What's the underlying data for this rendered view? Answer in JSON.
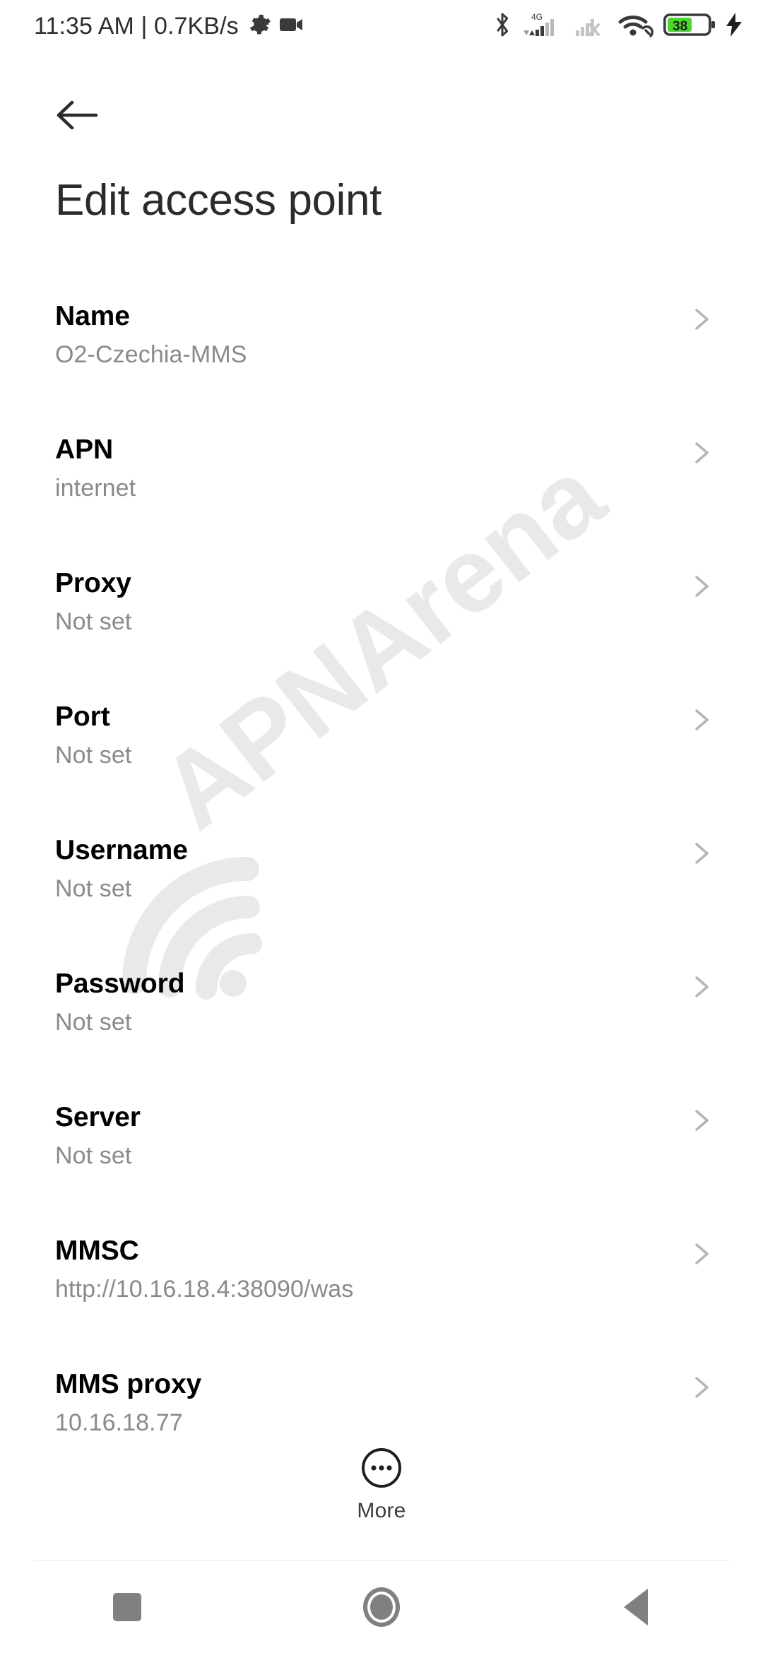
{
  "status_bar": {
    "time": "11:35 AM",
    "separator": "|",
    "data_speed": "0.7KB/s",
    "left_icons": [
      "gear-icon",
      "camcorder-icon"
    ],
    "network_label": "4G",
    "battery_percent": "38",
    "battery_color": "#4ad62f",
    "right_icons": [
      "bluetooth-icon",
      "signal-4g-icon",
      "signal-sim2-off-icon",
      "wifi-icon",
      "battery-icon",
      "charging-bolt-icon"
    ]
  },
  "app_bar": {
    "back_icon": "arrow-left-icon",
    "title": "Edit access point"
  },
  "watermark": {
    "text": "APNArena",
    "color": "#eaeaea"
  },
  "settings": {
    "rows": [
      {
        "title": "Name",
        "value": "O2-Czechia-MMS"
      },
      {
        "title": "APN",
        "value": "internet"
      },
      {
        "title": "Proxy",
        "value": "Not set"
      },
      {
        "title": "Port",
        "value": "Not set"
      },
      {
        "title": "Username",
        "value": "Not set"
      },
      {
        "title": "Password",
        "value": "Not set"
      },
      {
        "title": "Server",
        "value": "Not set"
      },
      {
        "title": "MMSC",
        "value": "http://10.16.18.4:38090/was"
      },
      {
        "title": "MMS proxy",
        "value": "10.16.18.77"
      }
    ],
    "chevron_icon": "chevron-right-icon"
  },
  "more_button": {
    "icon": "more-dots-circle-icon",
    "label": "More"
  },
  "nav_bar": {
    "recents": "recents-square-icon",
    "home": "home-circle-icon",
    "back": "back-triangle-icon"
  }
}
